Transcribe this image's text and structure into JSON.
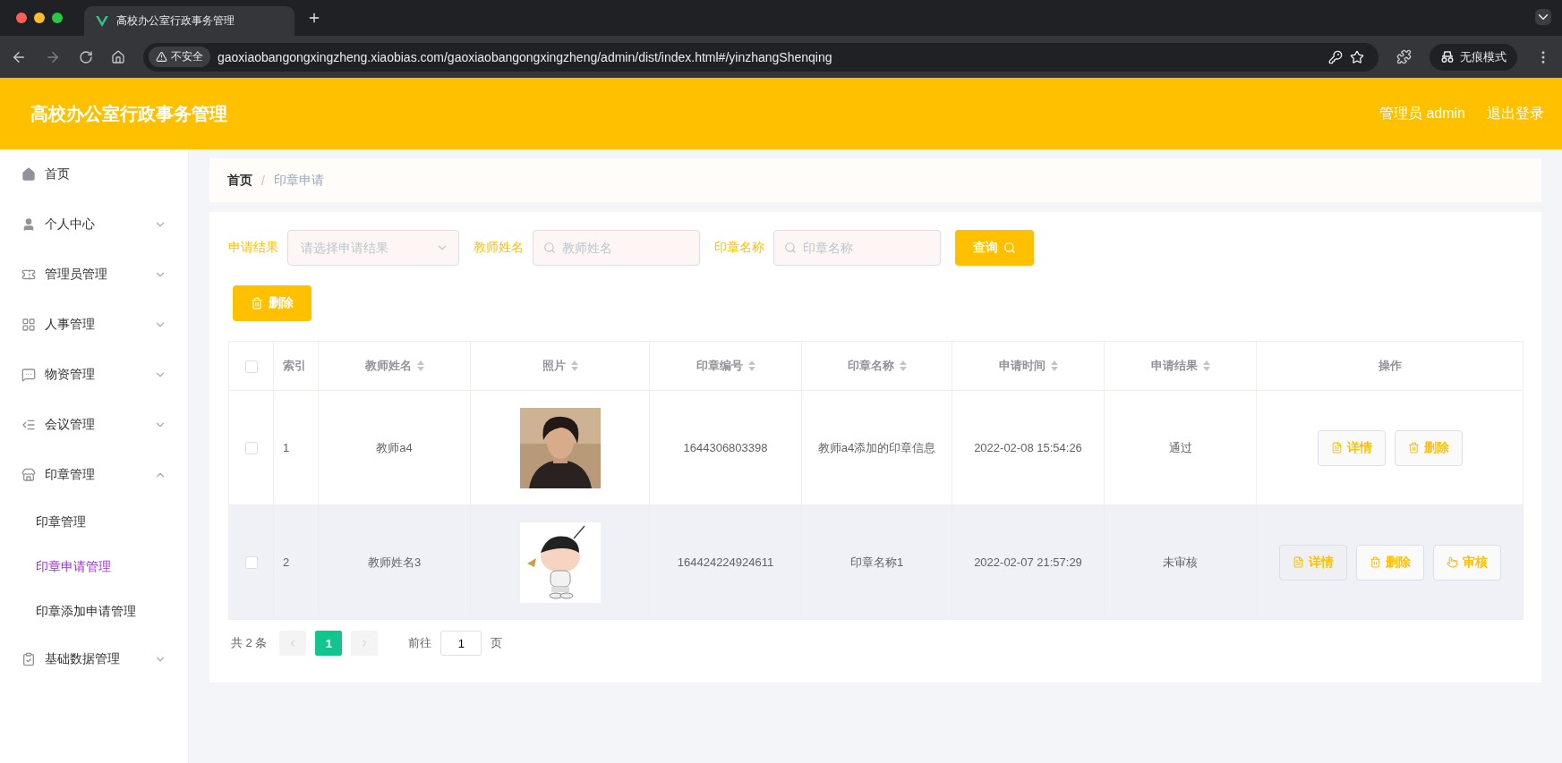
{
  "browser": {
    "tab_title": "高校办公室行政事务管理",
    "url_warning": "不安全",
    "url": "gaoxiaobangongxingzheng.xiaobias.com/gaoxiaobangongxingzheng/admin/dist/index.html#/yinzhangShenqing",
    "incognito": "无痕模式"
  },
  "header": {
    "title": "高校办公室行政事务管理",
    "user": "管理员 admin",
    "logout": "退出登录"
  },
  "sidebar": {
    "items": [
      {
        "label": "首页",
        "kind": "link"
      },
      {
        "label": "个人中心",
        "kind": "group",
        "expanded": false
      },
      {
        "label": "管理员管理",
        "kind": "group",
        "expanded": false
      },
      {
        "label": "人事管理",
        "kind": "group",
        "expanded": false
      },
      {
        "label": "物资管理",
        "kind": "group",
        "expanded": false
      },
      {
        "label": "会议管理",
        "kind": "group",
        "expanded": false
      },
      {
        "label": "印章管理",
        "kind": "group",
        "expanded": true,
        "children": [
          {
            "label": "印章管理",
            "selected": false
          },
          {
            "label": "印章申请管理",
            "selected": true
          },
          {
            "label": "印章添加申请管理",
            "selected": false
          }
        ]
      },
      {
        "label": "基础数据管理",
        "kind": "group",
        "expanded": false
      }
    ]
  },
  "breadcrumb": {
    "items": [
      "首页",
      "印章申请"
    ],
    "separator": "/"
  },
  "filters": [
    {
      "label": "申请结果",
      "kind": "select",
      "placeholder": "请选择申请结果"
    },
    {
      "label": "教师姓名",
      "kind": "search",
      "placeholder": "教师姓名"
    },
    {
      "label": "印章名称",
      "kind": "search",
      "placeholder": "印章名称"
    }
  ],
  "search_button": "查询",
  "delete_button": "删除",
  "table": {
    "select_all_checked": false,
    "columns": [
      {
        "label": "索引",
        "sortable": false
      },
      {
        "label": "教师姓名",
        "sortable": true
      },
      {
        "label": "照片",
        "sortable": true
      },
      {
        "label": "印章编号",
        "sortable": true
      },
      {
        "label": "印章名称",
        "sortable": true
      },
      {
        "label": "申请时间",
        "sortable": true
      },
      {
        "label": "申请结果",
        "sortable": true
      },
      {
        "label": "操作",
        "sortable": false
      }
    ],
    "rows": [
      {
        "checked": false,
        "highlighted": false,
        "index": "1",
        "teacher": "教师a4",
        "photo": {
          "kind": "picture"
        },
        "code": "1644306803398",
        "seal_name": "教师a4添加的印章信息",
        "time": "2022-02-08 15:54:26",
        "result": "通过",
        "actions": [
          {
            "label": "详情",
            "kind": "detail",
            "hovered": false
          },
          {
            "label": "删除",
            "kind": "delete",
            "hovered": false
          }
        ]
      },
      {
        "checked": false,
        "highlighted": true,
        "index": "2",
        "teacher": "教师姓名3",
        "photo": {
          "kind": "picture"
        },
        "code": "164424224924611",
        "seal_name": "印章名称1",
        "time": "2022-02-07 21:57:29",
        "result": "未审核",
        "actions": [
          {
            "label": "详情",
            "kind": "detail",
            "hovered": true
          },
          {
            "label": "删除",
            "kind": "delete",
            "hovered": false
          },
          {
            "label": "审核",
            "kind": "review",
            "hovered": false
          }
        ]
      }
    ]
  },
  "pagination": {
    "total": "共 2 条",
    "pages": [
      {
        "label": "1",
        "selected": true
      }
    ],
    "goto_label": "前往",
    "goto_value": "1",
    "page_suffix": "页"
  }
}
